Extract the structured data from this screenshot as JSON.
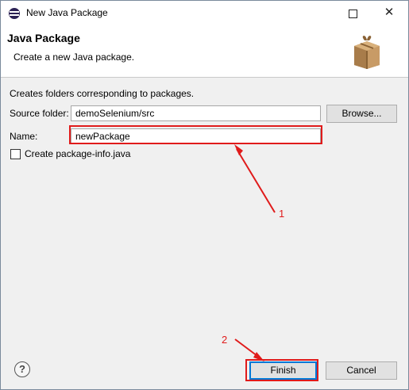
{
  "window": {
    "title": "New Java Package",
    "maximize_glyph": "",
    "close_glyph": "✕"
  },
  "banner": {
    "title": "Java Package",
    "subtitle": "Create a new Java package.",
    "icon": "package-box-icon"
  },
  "form": {
    "info": "Creates folders corresponding to packages.",
    "source_folder_label": "Source folder:",
    "source_folder_value": "demoSelenium/src",
    "browse_label": "Browse...",
    "name_label": "Name:",
    "name_value": "newPackage",
    "package_info_label": "Create package-info.java",
    "package_info_checked": false
  },
  "buttons": {
    "help_glyph": "?",
    "finish_label": "Finish",
    "cancel_label": "Cancel"
  },
  "annotations": {
    "color": "#e01b1b",
    "step1_label": "1",
    "step2_label": "2"
  }
}
